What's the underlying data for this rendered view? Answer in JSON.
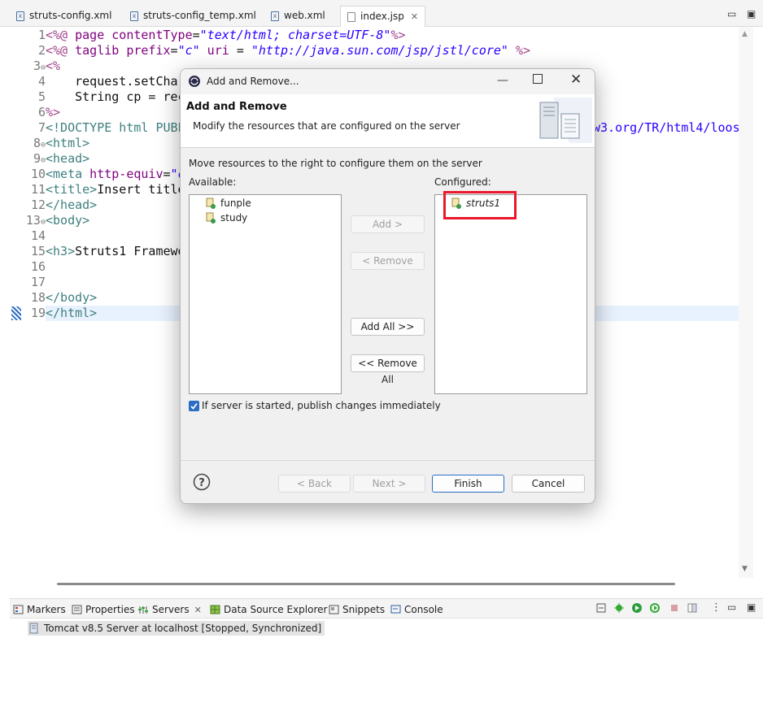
{
  "editor_tabs": [
    {
      "label": "struts-config.xml",
      "icon": "xml-file-icon"
    },
    {
      "label": "struts-config_temp.xml",
      "icon": "xml-file-icon"
    },
    {
      "label": "web.xml",
      "icon": "xml-file-icon"
    },
    {
      "label": "index.jsp",
      "icon": "jsp-file-icon",
      "active": true
    }
  ],
  "code_lines": {
    "l1": {
      "num": "1",
      "d1": "<%@",
      "k1": " page ",
      "a1": "contentType",
      "e1": "=",
      "v1": "\"text/html; charset=UTF-8\"",
      "d2": "%>"
    },
    "l2": {
      "num": "2",
      "d1": "<%@",
      "k1": " taglib ",
      "a1": "prefix",
      "e1": "=",
      "v1": "\"c\"",
      "a2": " uri ",
      "e2": "= ",
      "v2": "\"http://java.sun.com/jsp/jstl/core\"",
      "d2": " %>"
    },
    "l3": {
      "num": "3",
      "d1": "<%"
    },
    "l4": {
      "num": "4",
      "t": "    request.setChar"
    },
    "l5": {
      "num": "5",
      "t": "    String cp = rec"
    },
    "l6": {
      "num": "6",
      "d1": "%>"
    },
    "l7": {
      "num": "7",
      "t1": "<!DOCTYPE html PUBL",
      "t2": "w3.org/TR/html4/loos"
    },
    "l8": {
      "num": "8",
      "t": "<html>"
    },
    "l9": {
      "num": "9",
      "t": "<head>"
    },
    "l10": {
      "num": "10",
      "t1": "<meta",
      "a1": " http-equiv",
      "e1": "=",
      "v1": "\"c"
    },
    "l11": {
      "num": "11",
      "t1": "<title>",
      "p1": "Insert title"
    },
    "l12": {
      "num": "12",
      "t": "</head>"
    },
    "l13": {
      "num": "13",
      "t": "<body>"
    },
    "l14": {
      "num": "14"
    },
    "l15": {
      "num": "15",
      "t1": "<h3>",
      "p1": "Struts1 Framewo"
    },
    "l16": {
      "num": "16"
    },
    "l17": {
      "num": "17"
    },
    "l18": {
      "num": "18",
      "t": "</body>"
    },
    "l19": {
      "num": "19",
      "t": "</html>"
    }
  },
  "dialog": {
    "window_title": "Add and Remove...",
    "header_title": "Add and Remove",
    "header_desc": "Modify the resources that are configured on the server",
    "instruction": "Move resources to the right to configure them on the server",
    "available_label": "Available:",
    "configured_label": "Configured:",
    "available_items": [
      "funple",
      "study"
    ],
    "configured_items": [
      "struts1"
    ],
    "buttons": {
      "add": "Add >",
      "remove": "< Remove",
      "add_all": "Add All >>",
      "remove_all": "<< Remove All",
      "back": "< Back",
      "next": "Next >",
      "finish": "Finish",
      "cancel": "Cancel"
    },
    "publish_checkbox": {
      "label": "If server is started, publish changes immediately",
      "checked": true
    },
    "highlight_color": "#e8192c"
  },
  "bottom_tabs": [
    {
      "label": "Markers"
    },
    {
      "label": "Properties"
    },
    {
      "label": "Servers",
      "active": true
    },
    {
      "label": "Data Source Explorer"
    },
    {
      "label": "Snippets"
    },
    {
      "label": "Console"
    }
  ],
  "servers": [
    {
      "label": "Tomcat v8.5 Server at localhost  [Stopped, Synchronized]"
    }
  ]
}
